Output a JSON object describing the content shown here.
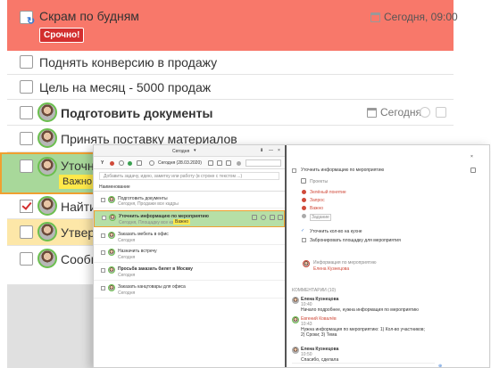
{
  "background_list": {
    "rows": [
      {
        "title": "Скрам по будням",
        "badge": "Срочно!",
        "date": "Сегодня, 09:00"
      },
      {
        "title": "Поднять конверсию в продажу"
      },
      {
        "title": "Цель на месяц - 5000 продаж"
      },
      {
        "title": "Подготовить документы",
        "date": "Сегодня"
      },
      {
        "title": "Принять поставку материалов"
      },
      {
        "title": "Уточнить",
        "badge": "Важно"
      },
      {
        "title": "Найти"
      },
      {
        "title": "Утвер"
      },
      {
        "title": "Сообщ"
      }
    ]
  },
  "app": {
    "toolbar": {
      "view_title": "Сегодня",
      "date_filter": "Сегодня (28.03.2020)"
    },
    "quick_add_placeholder": "Добавить задачу, идею, заметку или работу (в строке с текстом  ...)",
    "list_header": "Наименование",
    "tasks": [
      {
        "title": "Подготовить документы",
        "sub": "Сегодня, Продажи все кадры"
      },
      {
        "title": "Уточнить информацию по мероприятию",
        "sub": "Сегодня, Площадку все кадры",
        "badge": "Важно"
      },
      {
        "title": "Заказать мебель в офис",
        "sub": "Сегодня"
      },
      {
        "title": "Назначить встречу",
        "sub": "Сегодня"
      },
      {
        "title": "Просьба заказать билет в Москву",
        "sub": "Сегодня"
      },
      {
        "title": "Заказать канцтовары для офиса",
        "sub": "Сегодня"
      }
    ],
    "detail": {
      "title": "Уточнить информацию по мероприятию",
      "parent": "Проекты",
      "fields": [
        "Зелёный понятие",
        "Запрос",
        "Важно",
        "Задание"
      ],
      "checklist": [
        "Уточнить кол-во на кухне",
        "Забронировать площадку для мероприятия"
      ],
      "info_label": "Информация по мероприятию",
      "assignee": "Елена Кузнецова",
      "comments_header": "КОММЕНТАРИИ (10)",
      "comments": [
        {
          "author": "Елена Кузнецова",
          "time": "10:40",
          "text": "Начало подробнее, нужна информация по мероприятию"
        },
        {
          "author": "Евгений Ковалёв",
          "time": "10:43",
          "text": "Нужна информация по мероприятию: 1) Кол-во участников; 2) Сроки; 3) Тема"
        },
        {
          "author": "Елена Кузнецова",
          "time": "10:50",
          "text": "Спасибо, сделала"
        }
      ]
    }
  }
}
